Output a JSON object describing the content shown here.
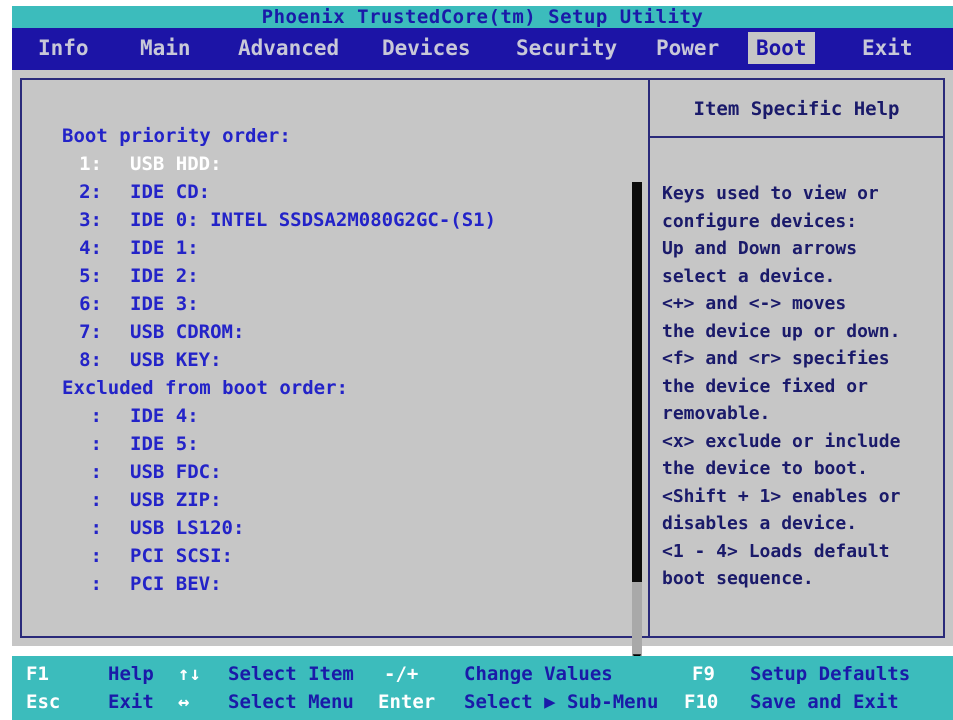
{
  "title": "Phoenix TrustedCore(tm) Setup Utility",
  "menu": [
    {
      "label": "Info"
    },
    {
      "label": "Main"
    },
    {
      "label": "Advanced"
    },
    {
      "label": "Devices"
    },
    {
      "label": "Security"
    },
    {
      "label": "Power"
    },
    {
      "label": "Boot",
      "active": true
    },
    {
      "label": "Exit"
    }
  ],
  "boot": {
    "priority_header": "Boot priority order:",
    "priority": [
      {
        "num": "1:",
        "device": "USB HDD:",
        "selected": true
      },
      {
        "num": "2:",
        "device": "IDE CD:"
      },
      {
        "num": "3:",
        "device": "IDE 0: INTEL SSDSA2M080G2GC-(S1)"
      },
      {
        "num": "4:",
        "device": "IDE 1:"
      },
      {
        "num": "5:",
        "device": "IDE 2:"
      },
      {
        "num": "6:",
        "device": "IDE 3:"
      },
      {
        "num": "7:",
        "device": "USB CDROM:"
      },
      {
        "num": "8:",
        "device": "USB KEY:"
      }
    ],
    "excluded_header": "Excluded from boot order:",
    "excluded": [
      {
        "num": ":",
        "device": "IDE 4:"
      },
      {
        "num": ":",
        "device": "IDE 5:"
      },
      {
        "num": ":",
        "device": "USB FDC:"
      },
      {
        "num": ":",
        "device": "USB ZIP:"
      },
      {
        "num": ":",
        "device": "USB LS120:"
      },
      {
        "num": ":",
        "device": "PCI SCSI:"
      },
      {
        "num": ":",
        "device": "PCI BEV:"
      }
    ]
  },
  "help": {
    "title": "Item Specific Help",
    "lines": [
      "Keys used to view or",
      "configure devices:",
      "Up and Down arrows",
      "select a device.",
      "<+> and <-> moves",
      "the device up or down.",
      "<f> and <r> specifies",
      "the device fixed or",
      "removable.",
      "<x> exclude or include",
      "the device to boot.",
      "<Shift + 1> enables or",
      "disables a device.",
      "<1 - 4> Loads default",
      "boot sequence."
    ]
  },
  "scroll_down_glyph": "▼",
  "keys": {
    "f1": "F1",
    "help": "Help",
    "updown": "↑↓",
    "select_item": "Select Item",
    "plusminus": "-/+",
    "change_values": "Change Values",
    "f9": "F9",
    "setup_defaults": "Setup Defaults",
    "esc": "Esc",
    "exit": "Exit",
    "leftright": "↔",
    "select_menu": "Select Menu",
    "enter": "Enter",
    "select_submenu": "Select ▶ Sub-Menu",
    "f10": "F10",
    "save_exit": "Save and Exit"
  },
  "colors": {
    "menu_bg": "#1c14a6",
    "title_bg": "#3cbcbc",
    "panel_bg": "#c6c6c6",
    "text_blue": "#2323c8",
    "selected_text": "#ffffff"
  }
}
